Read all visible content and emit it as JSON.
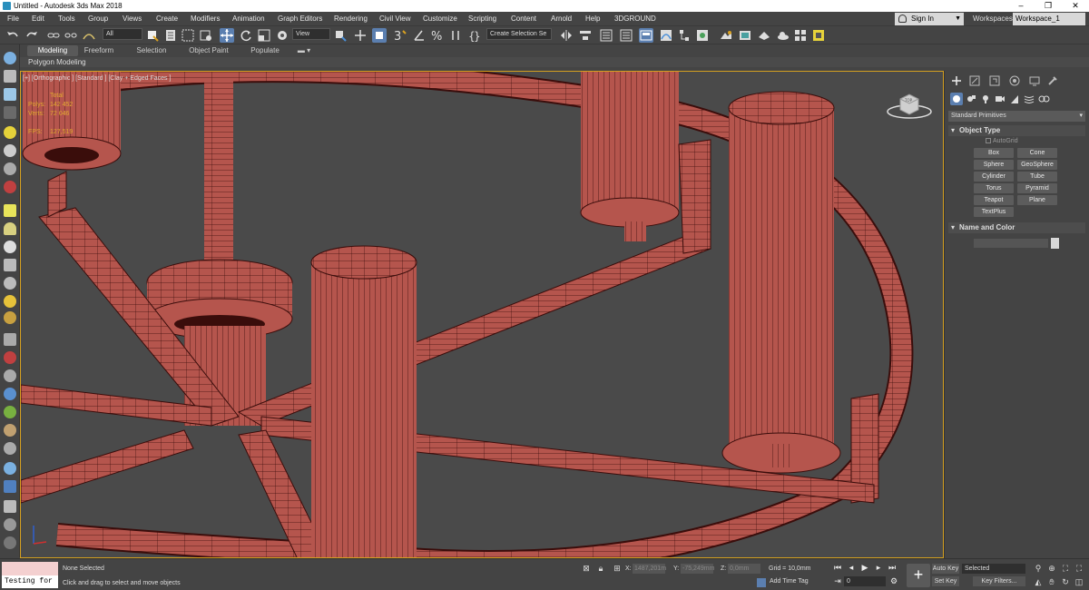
{
  "app": {
    "title": "Untitled - Autodesk 3ds Max 2018"
  },
  "window_controls": {
    "minimize": "–",
    "maximize": "❐",
    "close": "✕"
  },
  "menu": [
    "File",
    "Edit",
    "Tools",
    "Group",
    "Views",
    "Create",
    "Modifiers",
    "Animation",
    "Graph Editors",
    "Rendering",
    "Civil View",
    "Customize",
    "Scripting",
    "Content",
    "Arnold",
    "Help",
    "3DGROUND"
  ],
  "account": {
    "signin_label": "Sign In",
    "workspaces_label": "Workspaces:",
    "workspace_value": "Workspace_1"
  },
  "toolbar": {
    "selection_filter": "All",
    "ref_coord": "View",
    "named_selection_placeholder": "Create Selection Se",
    "snap_angle_label": "3",
    "snap_2_5_label": "2"
  },
  "ribbon": {
    "tabs": [
      "Modeling",
      "Freeform",
      "Selection",
      "Object Paint",
      "Populate"
    ],
    "active_tab": "Modeling",
    "panel_label": "Polygon Modeling"
  },
  "viewport": {
    "label": "[+] [Orthographic ] [Standard ] [Clay + Edged Faces ]",
    "stats": {
      "header": "Total",
      "polys_label": "Polys:",
      "polys_value": "142 452",
      "verts_label": "Verts:",
      "verts_value": "72 046",
      "fps_label": "FPS:",
      "fps_value": "127,519"
    },
    "viewcube_label": "TOP",
    "colors": {
      "background": "#4a4a4a",
      "mesh": "#b5554d",
      "wire": "#3a0d0b",
      "active_border": "#d4a020"
    }
  },
  "command_panel": {
    "tab_icons": [
      "create-icon",
      "modify-icon",
      "hierarchy-icon",
      "motion-icon",
      "display-icon",
      "utilities-icon"
    ],
    "category_icons": [
      "geometry-icon",
      "shapes-icon",
      "lights-icon",
      "cameras-icon",
      "helpers-icon",
      "space-warps-icon",
      "systems-icon"
    ],
    "type_dropdown": "Standard Primitives",
    "object_type_title": "Object Type",
    "autogrid_label": "AutoGrid",
    "objects": [
      "Box",
      "Cone",
      "Sphere",
      "GeoSphere",
      "Cylinder",
      "Tube",
      "Torus",
      "Pyramid",
      "Teapot",
      "Plane",
      "TextPlus"
    ],
    "name_color_title": "Name and Color"
  },
  "status": {
    "maxscript_value": "Testing for :",
    "selection_state": "None Selected",
    "prompt": "Click and drag to select and move objects",
    "x_label": "X:",
    "x_value": "1487,201m",
    "y_label": "Y:",
    "y_value": "-75,249mm",
    "z_label": "Z:",
    "z_value": "0,0mm",
    "grid": "Grid = 10,0mm",
    "add_time_tag": "Add Time Tag",
    "frame_value": "0",
    "auto_key": "Auto Key",
    "set_key": "Set Key",
    "selected_dropdown": "Selected",
    "key_filters": "Key Filters..."
  }
}
